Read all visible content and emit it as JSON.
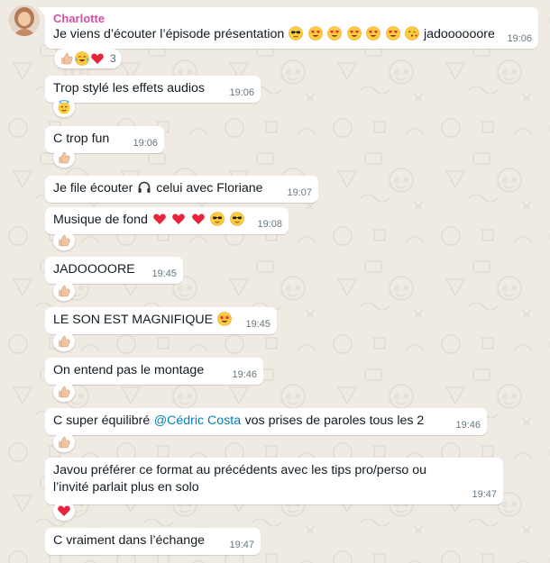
{
  "sender": {
    "name": "Charlotte",
    "name_color": "#cf52a0"
  },
  "messages": [
    {
      "text": "Je viens d’écouter l’épisode présentation",
      "suffix": "jadoooooore",
      "time": "19:06",
      "emojis": [
        "sunglasses-face",
        "heart-eyes-face",
        "heart-eyes-face",
        "heart-eyes-face",
        "heart-eyes-face",
        "heart-eyes-face",
        "kissing-heart-face"
      ],
      "reactions": [
        "thumbs-up",
        "joy-face",
        "red-heart"
      ],
      "reaction_count": "3"
    },
    {
      "text": "Trop stylé les effets audios",
      "time": "19:06",
      "reactions": [
        "smiling-face-halo"
      ]
    },
    {
      "text": "C trop fun",
      "time": "19:06",
      "reactions": [
        "thumbs-up"
      ]
    },
    {
      "text": "Je file écouter",
      "suffix": "celui avec Floriane",
      "time": "19:07",
      "emojis": [
        "headphones"
      ]
    },
    {
      "text": "Musique de fond",
      "time": "19:08",
      "emojis": [
        "red-heart",
        "red-heart",
        "red-heart",
        "sunglasses-face",
        "sunglasses-face"
      ],
      "reactions": [
        "thumbs-up"
      ]
    },
    {
      "text": "JADOOOORE",
      "time": "19:45",
      "reactions": [
        "thumbs-up"
      ]
    },
    {
      "text": "LE SON EST MAGNIFIQUE",
      "time": "19:45",
      "emojis": [
        "star-struck-face"
      ],
      "reactions": [
        "thumbs-up"
      ]
    },
    {
      "text": "On entend pas le montage",
      "time": "19:46",
      "reactions": [
        "thumbs-up"
      ]
    },
    {
      "text": "C super équilibré",
      "mention": "@Cédric Costa",
      "suffix": "vos prises de paroles tous les 2",
      "time": "19:46",
      "reactions": [
        "thumbs-up"
      ]
    },
    {
      "text": "Javou préférer ce format au précédents avec les tips pro/perso ou l’invité parlait plus en solo",
      "time": "19:47",
      "reactions": [
        "red-heart"
      ]
    },
    {
      "text": "C vraiment dans l’échange",
      "time": "19:47"
    }
  ]
}
